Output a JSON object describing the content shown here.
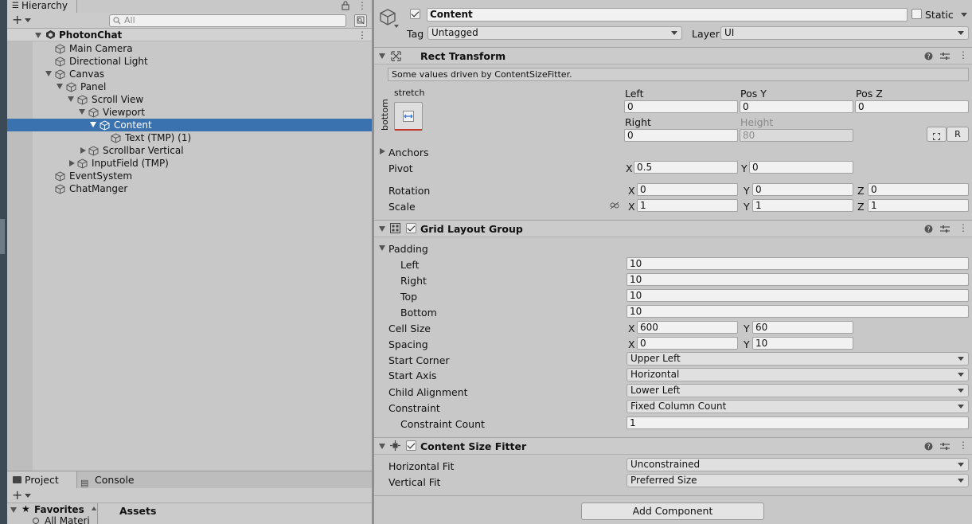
{
  "hierarchy": {
    "tab_label": "Hierarchy",
    "search_placeholder": "All",
    "scene_name": "PhotonChat",
    "items": [
      {
        "label": "Main Camera"
      },
      {
        "label": "Directional Light"
      },
      {
        "label": "Canvas"
      },
      {
        "label": "Panel"
      },
      {
        "label": "Scroll View"
      },
      {
        "label": "Viewport"
      },
      {
        "label": "Content",
        "selected": true
      },
      {
        "label": "Text (TMP) (1)"
      },
      {
        "label": "Scrollbar Vertical"
      },
      {
        "label": "InputField (TMP)"
      },
      {
        "label": "EventSystem"
      },
      {
        "label": "ChatManger"
      }
    ]
  },
  "project": {
    "tab_project": "Project",
    "tab_console": "Console",
    "favorites_label": "Favorites",
    "favorites_item": "All Materi",
    "assets_label": "Assets"
  },
  "inspector": {
    "object_name": "Content",
    "static_label": "Static",
    "tag_label": "Tag",
    "tag_value": "Untagged",
    "layer_label": "Layer",
    "layer_value": "UI",
    "rect_transform": {
      "title": "Rect Transform",
      "driven_note": "Some values driven by ContentSizeFitter.",
      "anchor_top_label": "stretch",
      "anchor_side_label": "bottom",
      "left_label": "Left",
      "left_value": "0",
      "posy_label": "Pos Y",
      "posy_value": "0",
      "posz_label": "Pos Z",
      "posz_value": "0",
      "right_label": "Right",
      "right_value": "0",
      "height_label": "Height",
      "height_value": "80",
      "r_button": "R",
      "anchors_label": "Anchors",
      "pivot_label": "Pivot",
      "pivot_x": "0.5",
      "pivot_y": "0",
      "rotation_label": "Rotation",
      "rot_x": "0",
      "rot_y": "0",
      "rot_z": "0",
      "scale_label": "Scale",
      "scale_x": "1",
      "scale_y": "1",
      "scale_z": "1",
      "x": "X",
      "y": "Y",
      "z": "Z"
    },
    "grid_layout": {
      "title": "Grid Layout Group",
      "padding_label": "Padding",
      "pad_left_label": "Left",
      "pad_left": "10",
      "pad_right_label": "Right",
      "pad_right": "10",
      "pad_top_label": "Top",
      "pad_top": "10",
      "pad_bottom_label": "Bottom",
      "pad_bottom": "10",
      "cell_size_label": "Cell Size",
      "cell_x": "600",
      "cell_y": "60",
      "spacing_label": "Spacing",
      "spacing_x": "0",
      "spacing_y": "10",
      "start_corner_label": "Start Corner",
      "start_corner": "Upper Left",
      "start_axis_label": "Start Axis",
      "start_axis": "Horizontal",
      "child_alignment_label": "Child Alignment",
      "child_alignment": "Lower Left",
      "constraint_label": "Constraint",
      "constraint": "Fixed Column Count",
      "constraint_count_label": "Constraint Count",
      "constraint_count": "1"
    },
    "content_size_fitter": {
      "title": "Content Size Fitter",
      "horizontal_fit_label": "Horizontal Fit",
      "horizontal_fit": "Unconstrained",
      "vertical_fit_label": "Vertical Fit",
      "vertical_fit": "Preferred Size"
    },
    "add_component": "Add Component"
  }
}
